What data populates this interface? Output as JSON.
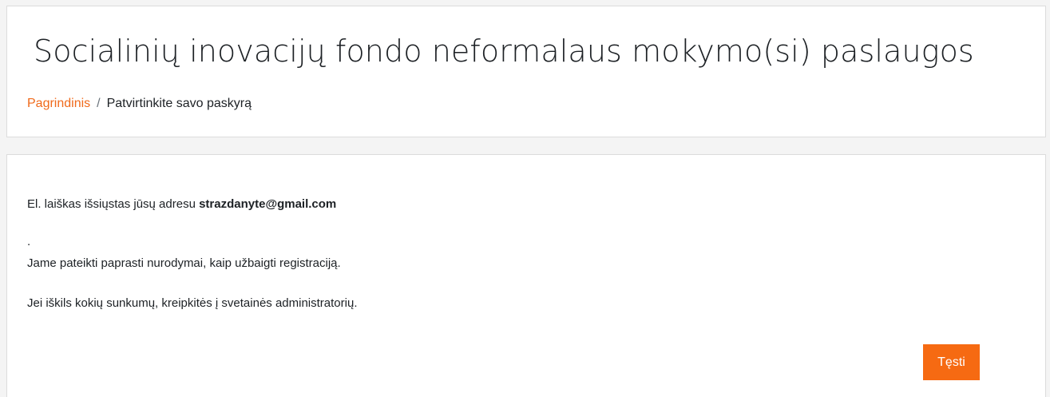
{
  "header": {
    "title": "Socialinių inovacijų fondo neformalaus mokymo(si) paslaugos",
    "breadcrumb": {
      "home": "Pagrindinis",
      "separator": "/",
      "current": "Patvirtinkite savo paskyrą"
    }
  },
  "content": {
    "sent_text": "El. laiškas išsiųstas jūsų adresu ",
    "email": "strazdanyte@gmail.com",
    "dot": ".",
    "instructions": "Jame pateikti paprasti nurodymai, kaip užbaigti registraciją.",
    "help": "Jei iškils kokių sunkumų, kreipkitės į svetainės administratorių.",
    "continue_label": "Tęsti"
  },
  "colors": {
    "accent": "#f66a12",
    "link": "#f06a1b"
  }
}
